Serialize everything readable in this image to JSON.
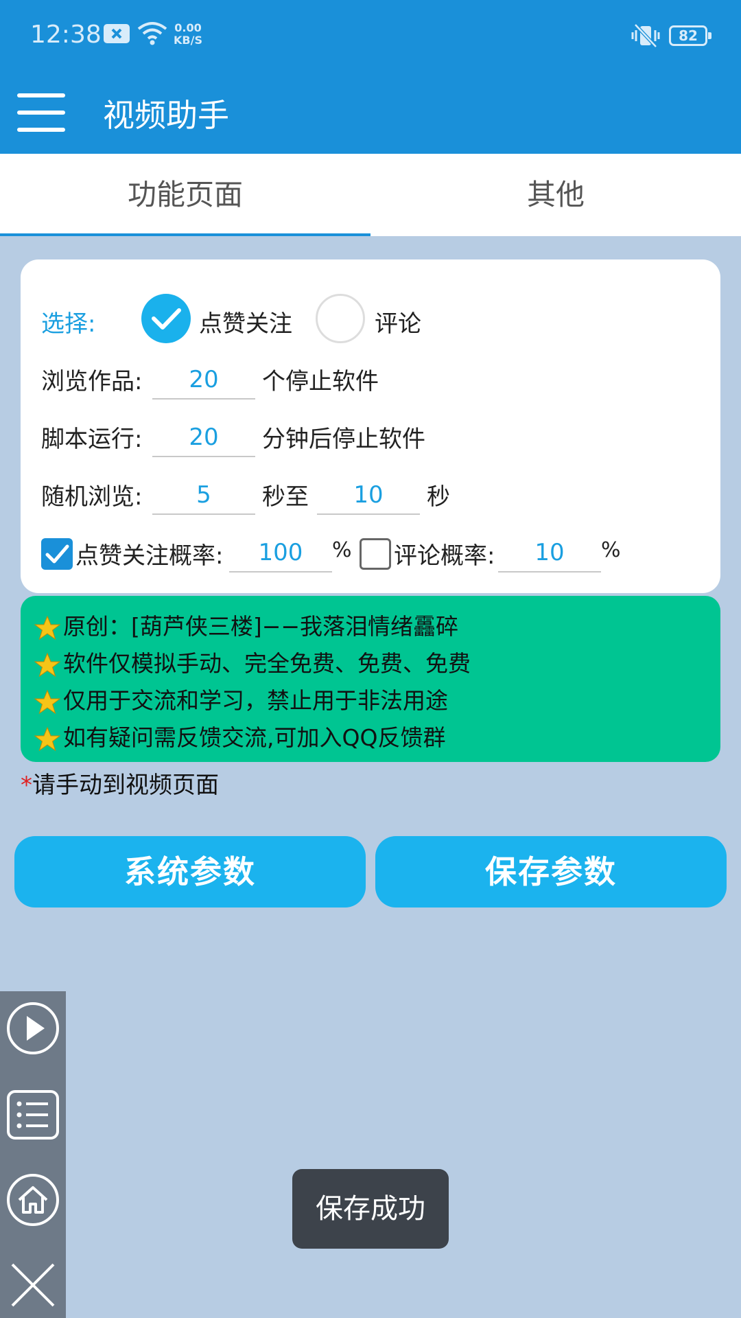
{
  "status": {
    "time": "12:38",
    "speed_value": "0.00",
    "speed_unit": "KB/S",
    "battery": "82"
  },
  "app": {
    "title": "视频助手"
  },
  "tabs": [
    {
      "label": "功能页面",
      "active": true
    },
    {
      "label": "其他",
      "active": false
    }
  ],
  "form": {
    "select_label": "选择:",
    "option_like_follow": "点赞关注",
    "option_comment": "评论",
    "selected_option": "点赞关注",
    "browse_label": "浏览作品:",
    "browse_value": "20",
    "browse_suffix": "个停止软件",
    "run_label": "脚本运行:",
    "run_value": "20",
    "run_suffix": "分钟后停止软件",
    "random_label": "随机浏览:",
    "random_min": "5",
    "random_mid": "秒至",
    "random_max": "10",
    "random_suffix": "秒",
    "like_prob_label": "点赞关注概率:",
    "like_prob_value": "100",
    "like_prob_checked": true,
    "comment_prob_label": "评论概率:",
    "comment_prob_value": "10",
    "comment_prob_checked": false,
    "percent": "%"
  },
  "notice": [
    "原创：[葫芦侠三楼]−−我落泪情绪靐碎",
    "软件仅模拟手动、完全免费、免费、免费",
    "仅用于交流和学习，禁止用于非法用途",
    "如有疑问需反馈交流,可加入QQ反馈群"
  ],
  "hint": {
    "mark": "*",
    "text": "请手动到视频页面"
  },
  "buttons": {
    "system": "系统参数",
    "save": "保存参数"
  },
  "toast": "保存成功",
  "colors": {
    "primary": "#1a90d9",
    "button": "#1bb3ee",
    "notice_bg": "#00c592",
    "page_bg": "#b7cce3"
  }
}
